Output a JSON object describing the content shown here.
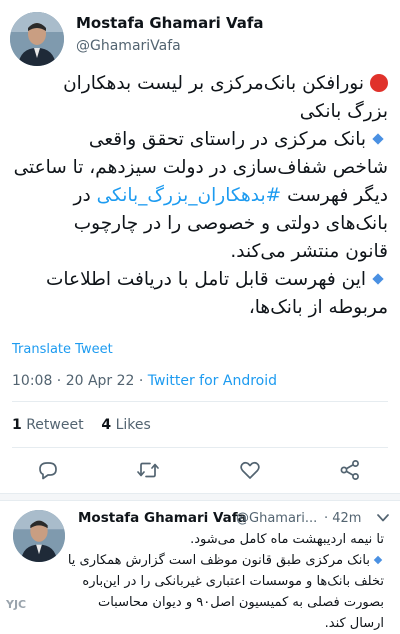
{
  "main_tweet": {
    "author_name": "Mostafa Ghamari Vafa",
    "author_handle": "@GhamariVafa",
    "lines": [
      {
        "marker": "red-dot",
        "text": "نورافکن بانک‌مرکزی بر لیست بدهکاران"
      },
      {
        "marker": "",
        "text": "بزرگ بانکی"
      },
      {
        "marker": "diamond",
        "text": "بانک مرکزی در راستای تحقق واقعی"
      },
      {
        "marker": "",
        "text": "شاخص شفاف‌سازی در دولت سیزدهم، تا ساعتی"
      },
      {
        "marker": "",
        "text": "دیگر فهرست",
        "hashtag": "#بدهکاران_بزرگ_بانکی",
        "after": "در"
      },
      {
        "marker": "",
        "text": "بانک‌های دولتی و خصوصی را در چارچوب"
      },
      {
        "marker": "",
        "text": "قانون منتشر می‌کند."
      },
      {
        "marker": "diamond",
        "text": "این فهرست قابل تامل با دریافت اطلاعات"
      },
      {
        "marker": "",
        "text": "مربوطه از بانک‌ها،"
      }
    ],
    "translate_label": "Translate Tweet",
    "timestamp": "10:08 · 20 Apr 22 · ",
    "source": "Twitter for Android",
    "retweets_count": "1",
    "retweets_label": "Retweet",
    "likes_count": "4",
    "likes_label": "Likes"
  },
  "actions": {
    "reply_icon": "reply-icon",
    "retweet_icon": "retweet-icon",
    "like_icon": "heart-icon",
    "share_icon": "share-icon"
  },
  "reply_tweet": {
    "author_name": "Mostafa Ghamari Vafa",
    "author_handle": "@Ghamari...",
    "time_ago": "· 42m",
    "more_icon": "more-icon",
    "lines": [
      {
        "marker": "",
        "text": "تا نیمه اردیبهشت ماه کامل می‌شود."
      },
      {
        "marker": "diamond",
        "text": "بانک مرکزی طبق قانون موظف است گزارش همکاری یا"
      },
      {
        "marker": "",
        "text": "تخلف بانک‌ها و موسسات اعتباری غیربانکی را در این‌باره"
      },
      {
        "marker": "",
        "text": "بصورت فصلی به کمیسیون اصل۹۰ و دیوان محاسبات"
      },
      {
        "marker": "",
        "text": "ارسال کند."
      }
    ]
  },
  "watermark": "YJC",
  "colors": {
    "accent": "#1d9bf0",
    "text": "#0f1419",
    "muted": "#536471",
    "red_dot": "#e0322b",
    "diamond": "#4a90e2"
  }
}
